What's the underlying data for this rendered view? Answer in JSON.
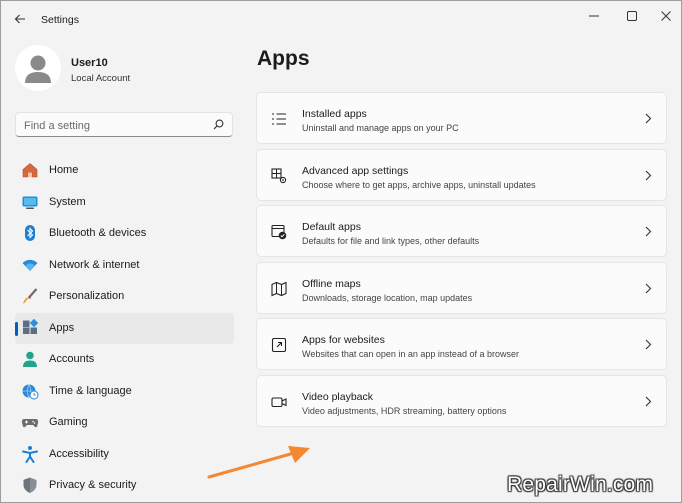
{
  "window": {
    "title": "Settings"
  },
  "profile": {
    "name": "User10",
    "account_type": "Local Account"
  },
  "search": {
    "placeholder": "Find a setting"
  },
  "sidebar": {
    "items": [
      {
        "label": "Home",
        "icon": "home-icon",
        "selected": false
      },
      {
        "label": "System",
        "icon": "system-icon",
        "selected": false
      },
      {
        "label": "Bluetooth & devices",
        "icon": "bluetooth-icon",
        "selected": false
      },
      {
        "label": "Network & internet",
        "icon": "network-icon",
        "selected": false
      },
      {
        "label": "Personalization",
        "icon": "brush-icon",
        "selected": false
      },
      {
        "label": "Apps",
        "icon": "apps-icon",
        "selected": true
      },
      {
        "label": "Accounts",
        "icon": "accounts-icon",
        "selected": false
      },
      {
        "label": "Time & language",
        "icon": "globe-clock-icon",
        "selected": false
      },
      {
        "label": "Gaming",
        "icon": "gamepad-icon",
        "selected": false
      },
      {
        "label": "Accessibility",
        "icon": "accessibility-icon",
        "selected": false
      },
      {
        "label": "Privacy & security",
        "icon": "shield-icon",
        "selected": false
      }
    ]
  },
  "main": {
    "title": "Apps",
    "cards": [
      {
        "title": "Installed apps",
        "description": "Uninstall and manage apps on your PC",
        "icon": "list-icon"
      },
      {
        "title": "Advanced app settings",
        "description": "Choose where to get apps, archive apps, uninstall updates",
        "icon": "app-gear-icon"
      },
      {
        "title": "Default apps",
        "description": "Defaults for file and link types, other defaults",
        "icon": "default-apps-icon"
      },
      {
        "title": "Offline maps",
        "description": "Downloads, storage location, map updates",
        "icon": "map-icon"
      },
      {
        "title": "Apps for websites",
        "description": "Websites that can open in an app instead of a browser",
        "icon": "app-website-icon"
      },
      {
        "title": "Video playback",
        "description": "Video adjustments, HDR streaming, battery options",
        "icon": "video-icon"
      }
    ]
  },
  "watermark": {
    "text": "RepairWin.com"
  },
  "colors": {
    "accent": "#005fb8",
    "annotation_arrow": "#f5872f",
    "background": "#f3f3f3",
    "card": "#fbfbfb"
  }
}
